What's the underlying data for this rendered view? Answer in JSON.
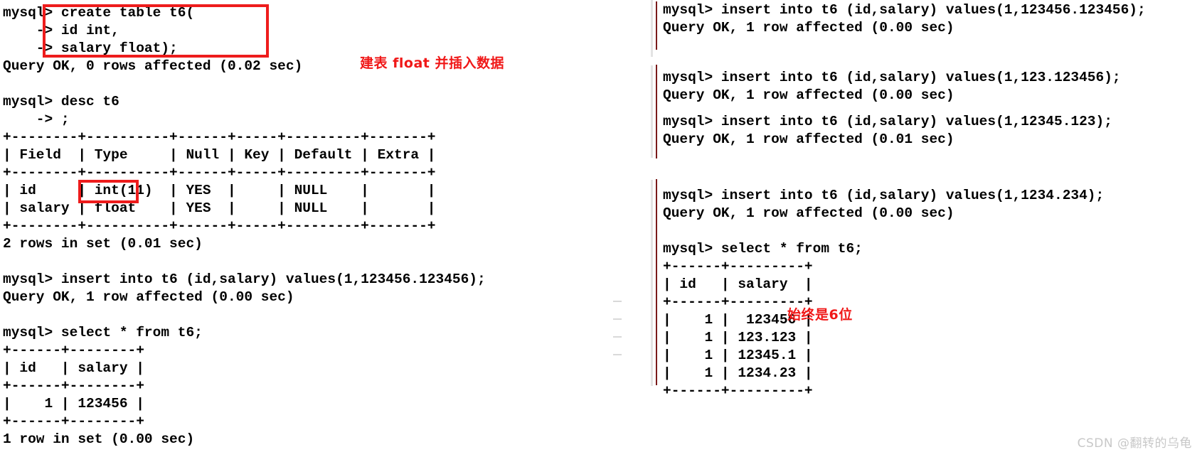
{
  "left_console": {
    "name": "mysql-client-left-pane",
    "text": "mysql> create table t6(\n    -> id int,\n    -> salary float);\nQuery OK, 0 rows affected (0.02 sec)\n\nmysql> desc t6\n    -> ;\n+--------+----------+------+-----+---------+-------+\n| Field  | Type     | Null | Key | Default | Extra |\n+--------+----------+------+-----+---------+-------+\n| id     | int(11)  | YES  |     | NULL    |       |\n| salary | float    | YES  |     | NULL    |       |\n+--------+----------+------+-----+---------+-------+\n2 rows in set (0.01 sec)\n\nmysql> insert into t6 (id,salary) values(1,123456.123456);\nQuery OK, 1 row affected (0.00 sec)\n\nmysql> select * from t6;\n+------+--------+\n| id   | salary |\n+------+--------+\n|    1 | 123456 |\n+------+--------+\n1 row in set (0.00 sec)"
  },
  "right_blocks": [
    {
      "name": "insert-123456-123456-block",
      "text": "mysql> insert into t6 (id,salary) values(1,123456.123456);\nQuery OK, 1 row affected (0.00 sec)"
    },
    {
      "name": "insert-123-123456-block",
      "text": "mysql> insert into t6 (id,salary) values(1,123.123456);\nQuery OK, 1 row affected (0.00 sec)"
    },
    {
      "name": "insert-12345-123-block",
      "text": "mysql> insert into t6 (id,salary) values(1,12345.123);\nQuery OK, 1 row affected (0.01 sec)"
    },
    {
      "name": "insert-1234-234-and-select-block",
      "text": "mysql> insert into t6 (id,salary) values(1,1234.234);\nQuery OK, 1 row affected (0.00 sec)\n\nmysql> select * from t6;\n+------+---------+\n| id   | salary  |\n+------+---------+\n|    1 |  123456 |\n|    1 | 123.123 |\n|    1 | 12345.1 |\n|    1 | 1234.23 |\n+------+---------+"
    }
  ],
  "annotations": [
    {
      "name": "annotation-create-float-insert",
      "text": "建表 float 并插入数据"
    },
    {
      "name": "annotation-always-six-digits",
      "text": "始终是6位"
    }
  ],
  "desc_table": {
    "columns": [
      "Field",
      "Type",
      "Null",
      "Key",
      "Default",
      "Extra"
    ],
    "rows": [
      [
        "id",
        "int(11)",
        "YES",
        "",
        "NULL",
        ""
      ],
      [
        "salary",
        "float",
        "YES",
        "",
        "NULL",
        ""
      ]
    ],
    "footer": "2 rows in set (0.01 sec)"
  },
  "select_table_left": {
    "columns": [
      "id",
      "salary"
    ],
    "rows": [
      [
        "1",
        "123456"
      ]
    ],
    "footer": "1 row in set (0.00 sec)"
  },
  "select_table_right": {
    "columns": [
      "id",
      "salary"
    ],
    "rows": [
      [
        "1",
        "123456"
      ],
      [
        "1",
        "123.123"
      ],
      [
        "1",
        "12345.1"
      ],
      [
        "1",
        "1234.23"
      ]
    ]
  },
  "highlight_color": "#ee1c1c",
  "annotation_color": "#f01818",
  "quote_rule_color": "#7a1b1b",
  "watermark": {
    "name": "csdn-watermark",
    "text": "CSDN @翻转的乌龟"
  }
}
